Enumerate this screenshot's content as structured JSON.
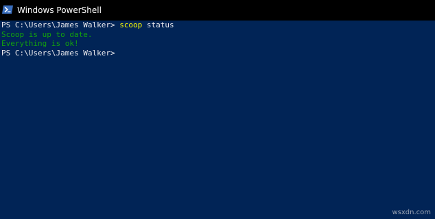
{
  "window": {
    "title": "Windows PowerShell",
    "icon": "powershell-icon"
  },
  "console": {
    "line1": {
      "prompt": "PS C:\\Users\\James Walker> ",
      "command": "scoop",
      "args": " status"
    },
    "line2": "Scoop is up to date.",
    "line3": "Everything is ok!",
    "line4": {
      "prompt": "PS C:\\Users\\James Walker>"
    }
  },
  "watermark": "wsxdn.com",
  "colors": {
    "background": "#012456",
    "titlebar": "#000000",
    "command": "#ffff00",
    "success": "#13a10e",
    "text": "#eeedf0"
  }
}
